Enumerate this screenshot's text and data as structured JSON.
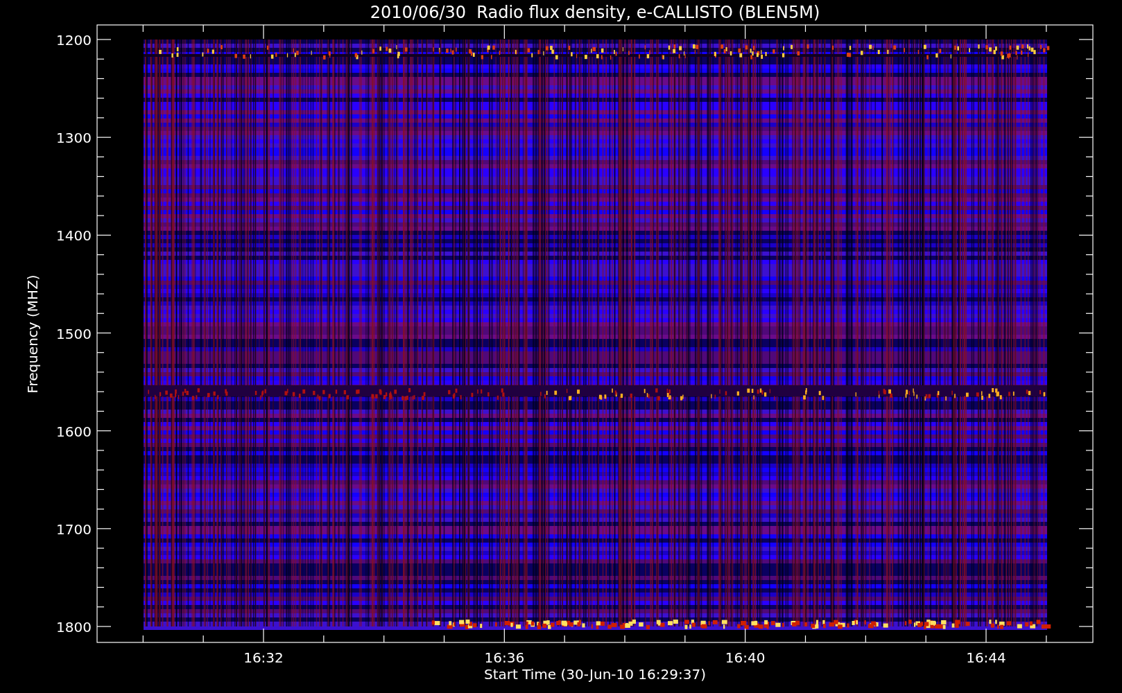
{
  "title": "2010/06/30  Radio flux density, e-CALLISTO (BLEN5M)",
  "y_axis": {
    "label": "Frequency (MHZ)",
    "ticks": [
      "1200",
      "1300",
      "1400",
      "1500",
      "1600",
      "1700",
      "1800"
    ]
  },
  "x_axis": {
    "label": "Start Time (30-Jun-10 16:29:37)",
    "ticks": [
      "16:32",
      "16:36",
      "16:40",
      "16:44"
    ]
  }
}
